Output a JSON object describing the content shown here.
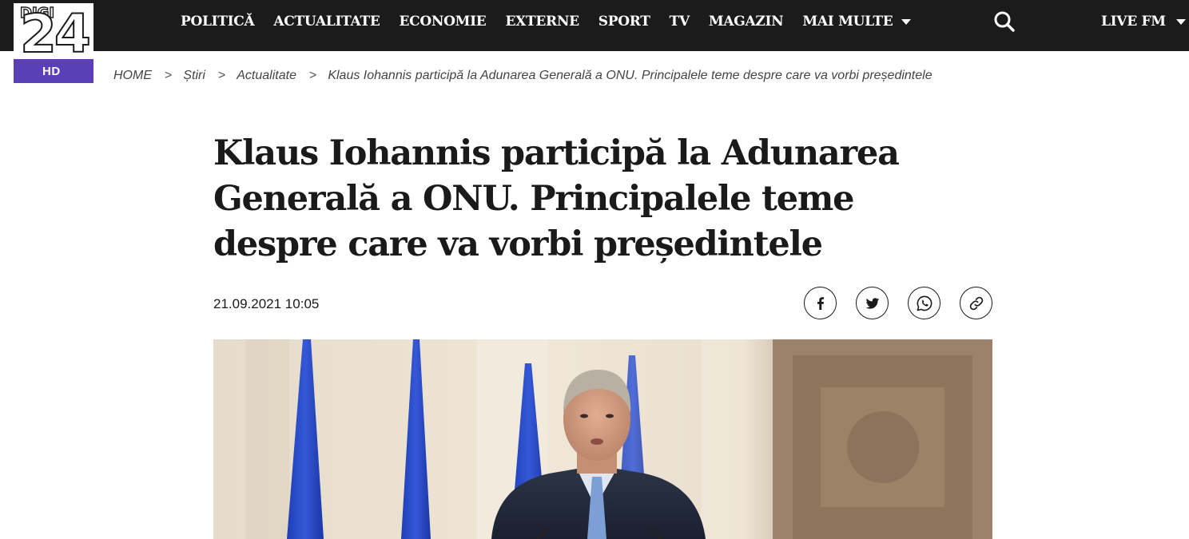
{
  "brand": {
    "logo_top": "DIGI",
    "logo_number": "24",
    "logo_badge": "HD",
    "badge_color": "#5a3fb8"
  },
  "nav": {
    "items": [
      {
        "label": "POLITICĂ"
      },
      {
        "label": "ACTUALITATE"
      },
      {
        "label": "ECONOMIE"
      },
      {
        "label": "EXTERNE"
      },
      {
        "label": "SPORT"
      },
      {
        "label": "TV"
      },
      {
        "label": "MAGAZIN"
      },
      {
        "label": "MAI MULTE",
        "dropdown": true
      }
    ],
    "search_icon": "search-icon",
    "live_label": "LIVE FM",
    "background": "#1b1b1b"
  },
  "breadcrumb": {
    "items": [
      {
        "label": "HOME"
      },
      {
        "label": "Știri"
      },
      {
        "label": "Actualitate"
      },
      {
        "label": "Klaus Iohannis participă la Adunarea Generală a ONU. Principalele teme despre care va vorbi președintele"
      }
    ],
    "separator": ">"
  },
  "article": {
    "title": "Klaus Iohannis participă la Adunarea Generală a ONU. Principalele teme despre care va vorbi președintele",
    "date": "21.09.2021 10:05",
    "share_icons": [
      "facebook-icon",
      "twitter-icon",
      "whatsapp-icon",
      "link-icon"
    ]
  }
}
